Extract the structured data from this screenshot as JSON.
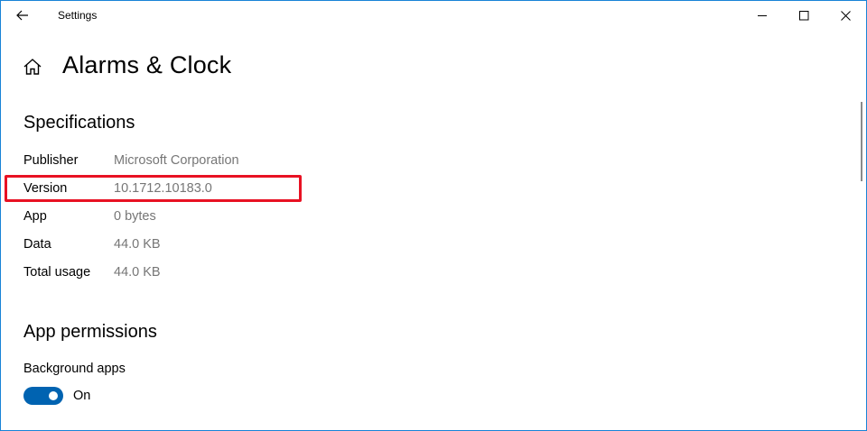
{
  "window": {
    "title": "Settings",
    "accent": "#1883d7"
  },
  "header": {
    "title": "Alarms & Clock"
  },
  "specifications": {
    "heading": "Specifications",
    "rows": [
      {
        "label": "Publisher",
        "value": "Microsoft Corporation"
      },
      {
        "label": "Version",
        "value": "10.1712.10183.0"
      },
      {
        "label": "App",
        "value": "0 bytes"
      },
      {
        "label": "Data",
        "value": "44.0 KB"
      },
      {
        "label": "Total usage",
        "value": "44.0 KB"
      }
    ]
  },
  "permissions": {
    "heading": "App permissions",
    "background_apps_label": "Background apps",
    "toggle_state": "On",
    "toggle_color": "#0063b1"
  },
  "annotation": {
    "highlight_color": "#e81123"
  }
}
